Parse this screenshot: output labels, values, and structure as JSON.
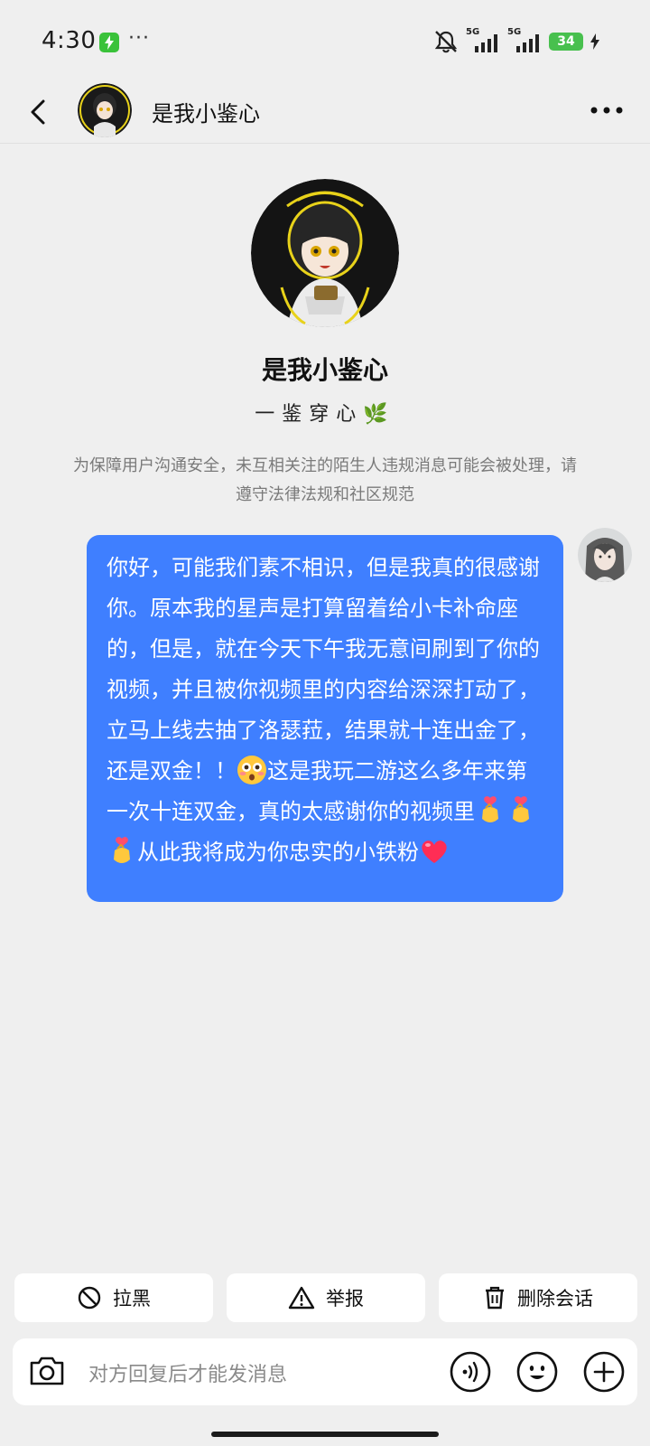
{
  "status_bar": {
    "time": "4:30",
    "dots": "···",
    "net1_label": "5G",
    "net2_label": "5G",
    "battery_level": "34",
    "colors": {
      "battery": "#48c04e",
      "charging_badge": "#3ac23a"
    }
  },
  "header": {
    "title": "是我小鉴心",
    "icons": [
      "back-arrow-icon",
      "avatar",
      "more-icon"
    ]
  },
  "profile": {
    "name": "是我小鉴心",
    "signature": "一鉴穿心🌿"
  },
  "notice": "为保障用户沟通安全，未互相关注的陌生人违规消息可能会被处理，请遵守法律法规和社区规范",
  "message": {
    "part1": "你好，可能我们素不相识，但是我真的很感谢你。原本我的星声是打算留着给小卡补命座的，但是，就在今天下午我无意间刷到了你的视频，并且被你视频里的内容给深深打动了，立马上线去抽了洛瑟菈，结果就十连出金了，还是双金！！",
    "part2": "这是我玩二游这么多年来第一次十连双金，真的太感谢你的视频里",
    "part3": "从此我将成为你忠实的小铁粉",
    "emojis": [
      "flushed-emoji",
      "finger-heart-emoji",
      "finger-heart-emoji",
      "finger-heart-emoji",
      "heart-emoji"
    ],
    "bubble_color": "#3f7fff"
  },
  "actions": {
    "block_label": "拉黑",
    "report_label": "举报",
    "delete_label": "删除会话"
  },
  "input": {
    "placeholder": "对方回复后才能发消息",
    "icons": [
      "camera-icon",
      "voice-icon",
      "emoji-icon",
      "plus-icon"
    ]
  }
}
